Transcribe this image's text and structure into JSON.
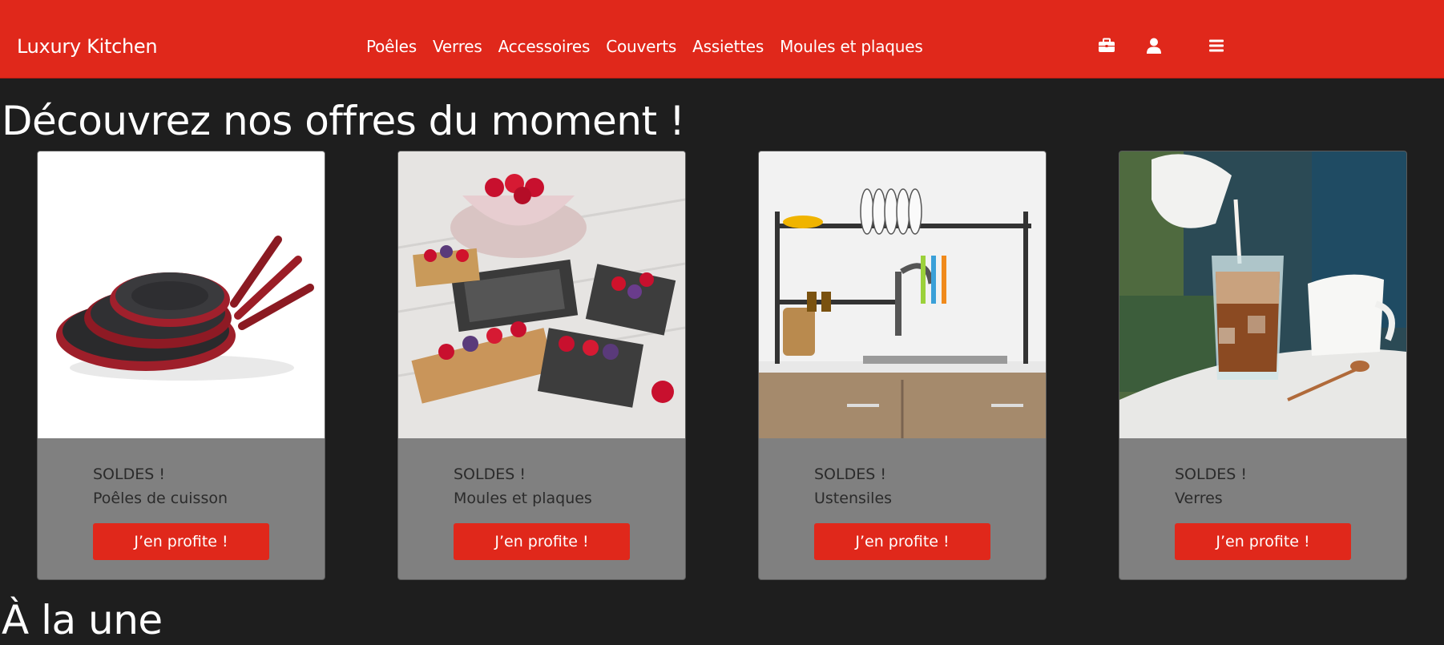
{
  "header": {
    "brand": "Luxury Kitchen",
    "nav": [
      "Poêles",
      "Verres",
      "Accessoires",
      "Couverts",
      "Assiettes",
      "Moules et plaques"
    ],
    "icons": [
      "briefcase-icon",
      "user-icon",
      "menu-icon"
    ]
  },
  "offers": {
    "title": "Découvrez nos offres du moment !",
    "cards": [
      {
        "badge": "SOLDES !",
        "category": "Poêles de cuisson",
        "button": "J’en profite !",
        "image": "frying-pans"
      },
      {
        "badge": "SOLDES !",
        "category": "Moules et plaques",
        "button": "J’en profite !",
        "image": "tart-molds"
      },
      {
        "badge": "SOLDES !",
        "category": "Ustensiles",
        "button": "J’en profite !",
        "image": "dish-rack"
      },
      {
        "badge": "SOLDES !",
        "category": "Verres",
        "button": "J’en profite !",
        "image": "iced-coffee-glass"
      }
    ]
  },
  "featured": {
    "title": "À la une"
  },
  "colors": {
    "accent": "#e0281b",
    "background": "#1e1e1e",
    "card": "#808080"
  }
}
